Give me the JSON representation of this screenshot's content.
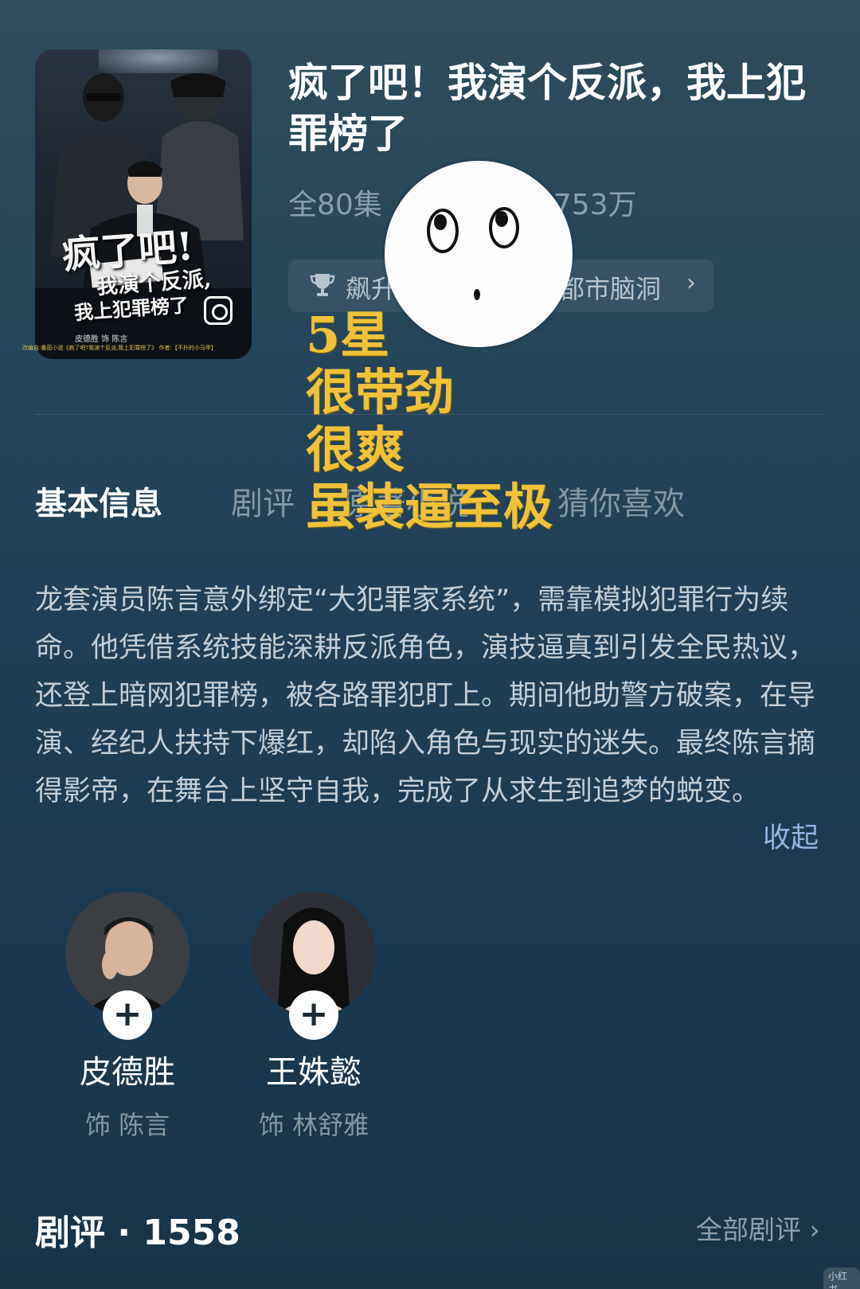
{
  "poster": {
    "title_line1": "疯了吧!",
    "title_line2": "我演个反派,",
    "title_line3": "我上犯罪榜了",
    "credit": "皮德胜   饰   陈言",
    "credit_small": "改编自:番茄小说《疯了吧?我演个反派,我上犯罪榜了》 作者:【不扑的小马甲】"
  },
  "drama": {
    "title": "疯了吧！我演个反派，我上犯罪榜了",
    "episodes": "全80集",
    "views_partial": "5753万",
    "tag_rank_partial": "飙升",
    "tag_genre": "都市脑洞",
    "tag_chevron": "›"
  },
  "overlay": {
    "lines": [
      "5星",
      "很带劲",
      "很爽",
      "虽装逼至极"
    ]
  },
  "tabs": [
    {
      "label": "基本信息",
      "active": true
    },
    {
      "label": "剧评",
      "active": false
    },
    {
      "label": "原著小说",
      "active": false
    },
    {
      "label": "猜你喜欢",
      "active": false
    }
  ],
  "synopsis": {
    "text": "龙套演员陈言意外绑定“大犯罪家系统”，需靠模拟犯罪行为续命。他凭借系统技能深耕反派角色，演技逼真到引发全民热议，还登上暗网犯罪榜，被各路罪犯盯上。期间他助警方破案，在导演、经纪人扶持下爆红，却陷入角色与现实的迷失。最终陈言摘得影帝，在舞台上坚守自我，完成了从求生到追梦的蜕变。",
    "collapse_label": "收起"
  },
  "cast": [
    {
      "name": "皮德胜",
      "role": "饰 陈言",
      "follow": "+"
    },
    {
      "name": "王姝懿",
      "role": "饰 林舒雅",
      "follow": "+"
    }
  ],
  "reviews": {
    "title": "剧评 · 1558",
    "all_label": "全部剧评 ›"
  },
  "watermark": "小红书",
  "colors": {
    "overlay_text": "#f0c23a",
    "link": "#8fb7e0",
    "muted": "#8497a4"
  }
}
